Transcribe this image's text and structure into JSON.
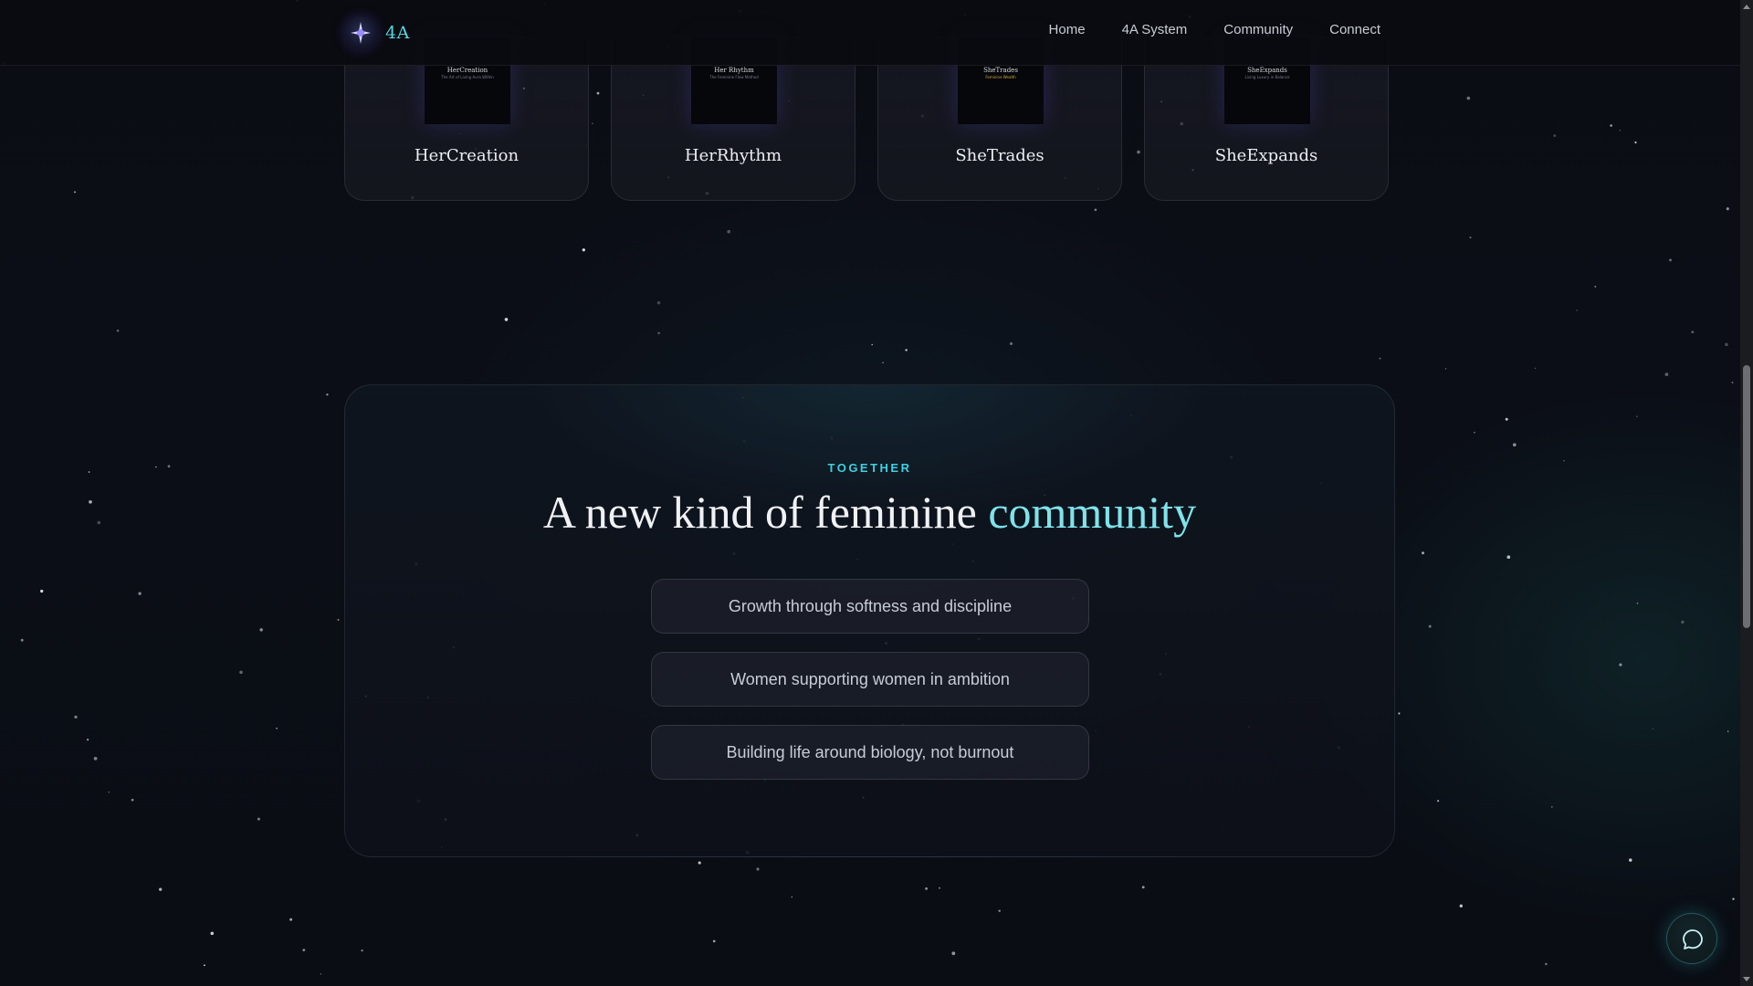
{
  "brand": {
    "name": "4A",
    "logo_icon": "sparkle-logo-icon"
  },
  "nav": {
    "links": [
      {
        "label": "Home"
      },
      {
        "label": "4A System"
      },
      {
        "label": "Community"
      },
      {
        "label": "Connect"
      }
    ]
  },
  "programs": [
    {
      "title": "HerCreation",
      "cover_title": "HerCreation",
      "cover_sub": "The Art of Living Aura Within"
    },
    {
      "title": "HerRhythm",
      "cover_title": "Her Rhythm",
      "cover_sub": "The Feminine Flow Method"
    },
    {
      "title": "SheTrades",
      "cover_title": "SheTrades",
      "cover_sub": "Feminine Wealth"
    },
    {
      "title": "SheExpands",
      "cover_title": "SheExpands",
      "cover_sub": "Living Luxury in Balance"
    }
  ],
  "community": {
    "eyebrow": "TOGETHER",
    "headline_main": "A new kind of feminine ",
    "headline_accent": "community",
    "pillars": [
      "Growth through softness and discipline",
      "Women supporting women in ambition",
      "Building life around biology, not burnout"
    ]
  },
  "chat": {
    "icon": "chat-bubble-icon"
  },
  "colors": {
    "background": "#0a0c12",
    "accent_teal": "#3fd0df",
    "accent_light": "#7fe3ea",
    "text_primary": "#f0f1f5"
  }
}
